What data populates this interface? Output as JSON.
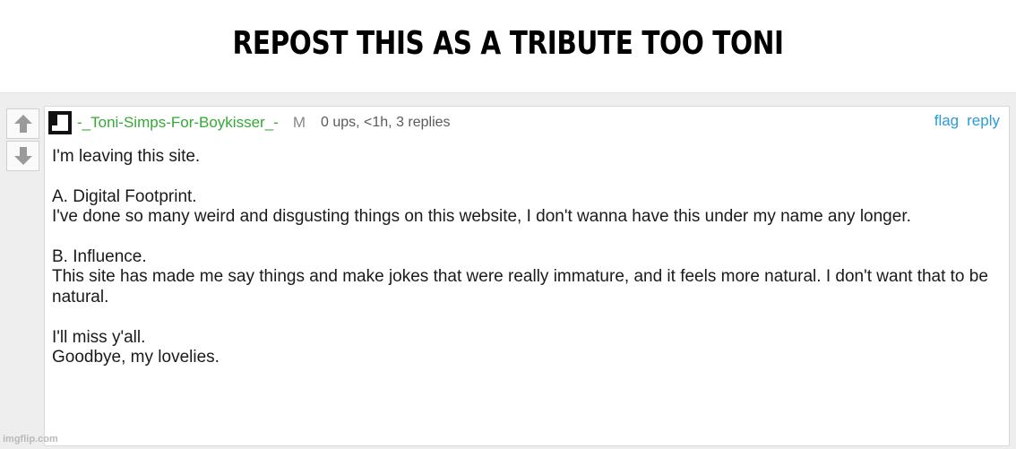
{
  "banner": {
    "title": "REPOST THIS AS A TRIBUTE TOO TONI"
  },
  "vote": {
    "upvote_icon": "arrow-up-icon",
    "downvote_icon": "arrow-down-icon"
  },
  "comment": {
    "avatar_icon": "pixel-avatar-icon",
    "username": "-_Toni-Simps-For-Boykisser_-",
    "badge": "M",
    "meta": "0 ups, <1h, 3 replies",
    "actions": {
      "flag": "flag",
      "reply": "reply"
    },
    "paragraphs": [
      [
        "I'm leaving this site."
      ],
      [
        "A. Digital Footprint.",
        "I've done so many weird and disgusting things on this website, I don't wanna have this under my name any longer."
      ],
      [
        "B. Influence.",
        "This site has made me say things and make jokes that were really immature, and it feels more natural. I don't want that to be natural."
      ],
      [
        "I'll miss y'all.",
        "Goodbye, my lovelies."
      ]
    ]
  },
  "watermark": "imgflip.com",
  "colors": {
    "username": "#36a836",
    "action_link": "#2b9cd6",
    "meta": "#5a5a5a"
  }
}
